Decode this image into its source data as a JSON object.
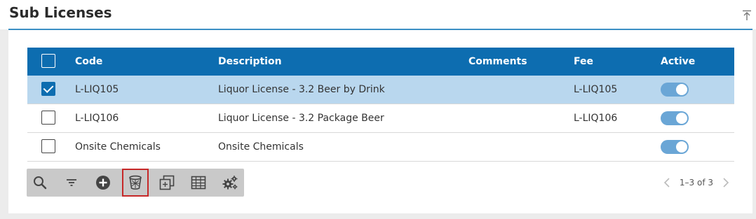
{
  "section": {
    "title": "Sub Licenses"
  },
  "grid": {
    "columns": {
      "code": "Code",
      "description": "Description",
      "comments": "Comments",
      "fee": "Fee",
      "active": "Active"
    },
    "rows": [
      {
        "code": "L-LIQ105",
        "description": "Liquor License - 3.2 Beer by Drink",
        "comments": "",
        "fee": "L-LIQ105",
        "active": true,
        "selected": true
      },
      {
        "code": "L-LIQ106",
        "description": "Liquor License - 3.2 Package Beer",
        "comments": "",
        "fee": "L-LIQ106",
        "active": true,
        "selected": false
      },
      {
        "code": "Onsite Chemicals",
        "description": "Onsite Chemicals",
        "comments": "",
        "fee": "",
        "active": true,
        "selected": false
      }
    ]
  },
  "toolbar": {
    "buttons": [
      "search-icon",
      "filter-icon",
      "add-icon",
      "delete-icon",
      "copy-icon",
      "grid-layout-icon",
      "settings-icon"
    ],
    "active_button": "delete-icon"
  },
  "pager": {
    "range": "1–3 of 3"
  },
  "colors": {
    "header": "#0d6db0",
    "selected_row": "#b9d7ee",
    "toggle": "#6aa6d6",
    "highlight_border": "#c62828"
  }
}
